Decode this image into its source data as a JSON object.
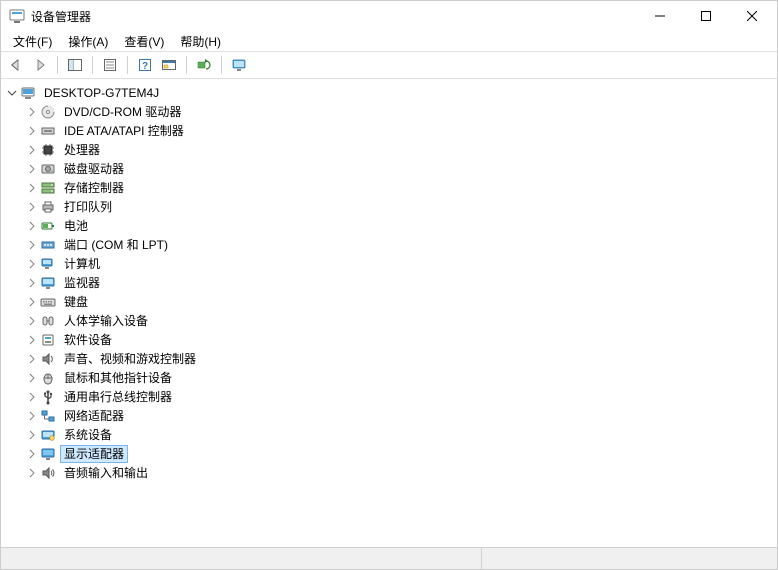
{
  "window": {
    "title": "设备管理器"
  },
  "menu": {
    "file": "文件(F)",
    "action": "操作(A)",
    "view": "查看(V)",
    "help": "帮助(H)"
  },
  "tree": {
    "root": {
      "label": "DESKTOP-G7TEM4J",
      "expanded": true
    },
    "children": [
      {
        "label": "DVD/CD-ROM 驱动器",
        "icon": "disc"
      },
      {
        "label": "IDE ATA/ATAPI 控制器",
        "icon": "ide"
      },
      {
        "label": "处理器",
        "icon": "cpu"
      },
      {
        "label": "磁盘驱动器",
        "icon": "disk"
      },
      {
        "label": "存储控制器",
        "icon": "storage"
      },
      {
        "label": "打印队列",
        "icon": "printer"
      },
      {
        "label": "电池",
        "icon": "battery"
      },
      {
        "label": "端口 (COM 和 LPT)",
        "icon": "port"
      },
      {
        "label": "计算机",
        "icon": "computer"
      },
      {
        "label": "监视器",
        "icon": "monitor"
      },
      {
        "label": "键盘",
        "icon": "keyboard"
      },
      {
        "label": "人体学输入设备",
        "icon": "hid"
      },
      {
        "label": "软件设备",
        "icon": "software"
      },
      {
        "label": "声音、视频和游戏控制器",
        "icon": "sound"
      },
      {
        "label": "鼠标和其他指针设备",
        "icon": "mouse"
      },
      {
        "label": "通用串行总线控制器",
        "icon": "usb"
      },
      {
        "label": "网络适配器",
        "icon": "network"
      },
      {
        "label": "系统设备",
        "icon": "system"
      },
      {
        "label": "显示适配器",
        "icon": "display",
        "selected": true
      },
      {
        "label": "音频输入和输出",
        "icon": "audio"
      }
    ]
  }
}
